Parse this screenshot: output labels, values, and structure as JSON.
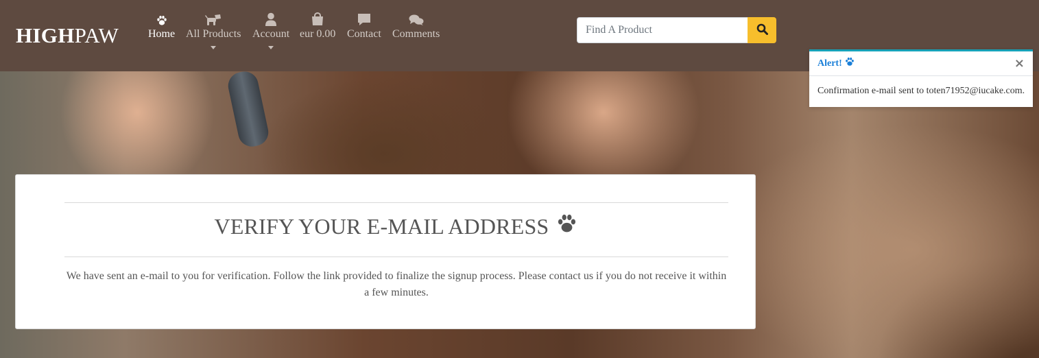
{
  "brand": {
    "bold": "HIGH",
    "light": "PAW"
  },
  "nav": {
    "items": [
      {
        "label": "Home",
        "icon": "paw-icon",
        "active": true,
        "dropdown": false
      },
      {
        "label": "All Products",
        "icon": "dog-icon",
        "active": false,
        "dropdown": true
      },
      {
        "label": "Account",
        "icon": "user-icon",
        "active": false,
        "dropdown": true
      },
      {
        "label": "eur 0.00",
        "icon": "shopping-bag-icon",
        "active": false,
        "dropdown": false
      },
      {
        "label": "Contact",
        "icon": "comment-icon",
        "active": false,
        "dropdown": false
      },
      {
        "label": "Comments",
        "icon": "comments-icon",
        "active": false,
        "dropdown": false
      }
    ]
  },
  "search": {
    "placeholder": "Find A Product",
    "button_icon": "search-icon"
  },
  "toast": {
    "title": "Alert!",
    "title_icon": "paw-icon",
    "message": "Confirmation e-mail sent to toten71952@iucake.com."
  },
  "card": {
    "title": "VERIFY YOUR E-MAIL ADDRESS",
    "title_icon": "paw-icon",
    "text": "We have sent an e-mail to you for verification. Follow the link provided to finalize the signup process. Please contact us if you do not receive it within a few minutes."
  },
  "colors": {
    "navbar": "#5e4a40",
    "search_button": "#f7be2c",
    "toast_accent": "#17a2b8",
    "toast_title": "#1a7fd8"
  }
}
